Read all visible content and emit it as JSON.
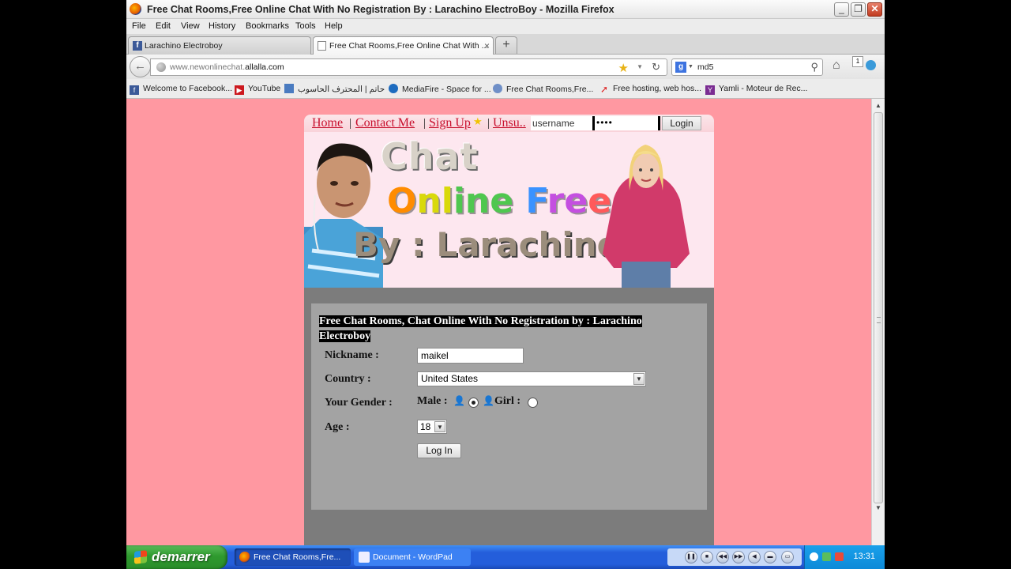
{
  "window": {
    "title": "Free Chat Rooms,Free Online Chat With No Registration By : Larachino ElectroBoy - Mozilla Firefox",
    "buttons": {
      "minimize": "_",
      "restore": "❐",
      "close": "✕"
    }
  },
  "menu": [
    "File",
    "Edit",
    "View",
    "History",
    "Bookmarks",
    "Tools",
    "Help"
  ],
  "tabs": [
    {
      "label": "Larachino Electroboy",
      "active": false
    },
    {
      "label": "Free Chat Rooms,Free Online Chat With ...",
      "active": true
    }
  ],
  "new_tab": "+",
  "tab_close": "×",
  "address": {
    "prefix": "www.newonlinechat.",
    "domain": "allalla.com"
  },
  "search": {
    "value": "md5",
    "engine_letter": "g"
  },
  "addon_badge": "1",
  "bookmarks": [
    {
      "label": "Welcome to Facebook...",
      "icon": "facebook-icon",
      "color": "#3b5998"
    },
    {
      "label": "YouTube",
      "icon": "youtube-icon",
      "color": "#cc181e"
    },
    {
      "label": "حاتم | المحترف الحاسوب",
      "icon": "computer-icon",
      "color": "#4a7bc0"
    },
    {
      "label": "MediaFire - Space for ...",
      "icon": "mediafire-icon",
      "color": "#1d6bbf"
    },
    {
      "label": "Free Chat Rooms,Fre...",
      "icon": "chat-icon",
      "color": "#6f8fc7"
    },
    {
      "label": "Free hosting, web hos...",
      "icon": "hosting-icon",
      "color": "#d22"
    },
    {
      "label": "Yamli - Moteur de Rec...",
      "icon": "yamli-icon",
      "color": "#7b2c92"
    }
  ],
  "site": {
    "nav": {
      "home": "Home",
      "contact": "Contact Me",
      "signup": "Sign Up",
      "unsub": "Unsu..",
      "sep": "|",
      "username_value": "username",
      "password_mask": "••••",
      "login_label": "Login"
    },
    "banner": {
      "line1": "Chat",
      "line2": [
        "O",
        "nl",
        "ine ",
        "F",
        "re",
        "e"
      ],
      "line3": "By : Larachino"
    },
    "form": {
      "heading": "Free Chat Rooms, Chat Online With No Registration by : Larachino Electroboy",
      "nickname_label": "Nickname :",
      "nickname_value": "maikel",
      "country_label": "Country :",
      "country_value": "United States",
      "gender_label": "Your Gender :",
      "male_label": "Male :",
      "girl_label": "Girl :",
      "gender_selected": "male",
      "age_label": "Age :",
      "age_value": "18",
      "login_button": "Log In"
    }
  },
  "taskbar": {
    "start_label": "demarrer",
    "tasks": [
      {
        "label": "Free Chat Rooms,Fre...",
        "active": true
      },
      {
        "label": "Document - WordPad",
        "active": false
      }
    ],
    "clock": "13:31"
  }
}
